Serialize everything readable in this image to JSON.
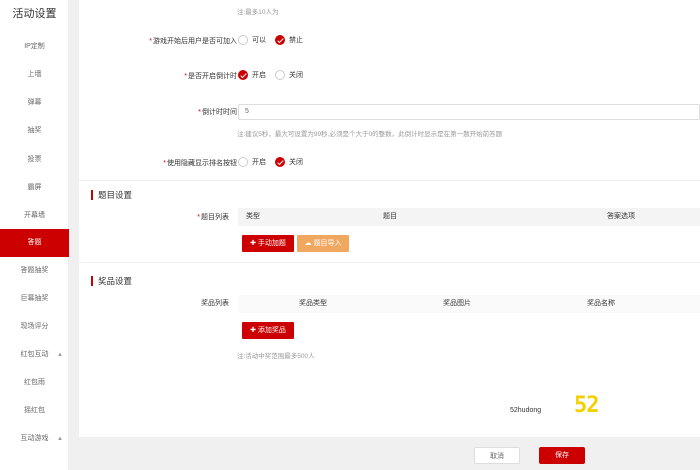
{
  "sidebar": {
    "title": "活动设置",
    "items": [
      {
        "label": "IP定制",
        "active": false
      },
      {
        "label": "上墙",
        "active": false
      },
      {
        "label": "弹幕",
        "active": false
      },
      {
        "label": "抽奖",
        "active": false
      },
      {
        "label": "投票",
        "active": false
      },
      {
        "label": "霸屏",
        "active": false
      },
      {
        "label": "开幕墙",
        "active": false
      },
      {
        "label": "答题",
        "active": true
      },
      {
        "label": "答题抽奖",
        "active": false
      },
      {
        "label": "巨幕抽奖",
        "active": false
      },
      {
        "label": "现场评分",
        "active": false
      },
      {
        "label": "红包互动",
        "active": false,
        "expandable": true
      },
      {
        "label": "红包雨",
        "active": false
      },
      {
        "label": "摇红包",
        "active": false
      },
      {
        "label": "互动游戏",
        "active": false,
        "expandable": true
      }
    ]
  },
  "form": {
    "top_note": "注:最多10人为",
    "join_label": "游戏开始后用户是否可加入",
    "join_options": [
      {
        "label": "可以",
        "checked": false
      },
      {
        "label": "禁止",
        "checked": true
      }
    ],
    "countdown_label": "是否开启倒计时",
    "countdown_options": [
      {
        "label": "开启",
        "checked": true
      },
      {
        "label": "关闭",
        "checked": false
      }
    ],
    "countdown_time_label": "倒计时时间",
    "countdown_time_value": "5",
    "countdown_note": "注:建议5秒，最大可设置为99秒,必须是个大于0的整数，此倒计时显示是在第一题开始前答题",
    "ranking_label": "使用隐藏显示排名按钮",
    "ranking_options": [
      {
        "label": "开启",
        "checked": false
      },
      {
        "label": "关闭",
        "checked": true
      }
    ]
  },
  "questions": {
    "section_title": "题目设置",
    "list_label": "题目列表",
    "columns": [
      "类型",
      "题目",
      "答案选项"
    ],
    "add_button": "✚ 手动加题",
    "import_button": "☁ 题目导入"
  },
  "prizes": {
    "section_title": "奖品设置",
    "list_label": "奖品列表",
    "columns": [
      "奖品类型",
      "奖品图片",
      "奖品名称"
    ],
    "add_button": "✚ 添加奖品",
    "note": "注:活动中奖范围最多500人"
  },
  "footer": {
    "cancel": "取消",
    "save": "保存"
  },
  "watermark": {
    "text": "52hudong",
    "logo": "52"
  },
  "colors": {
    "accent": "#cc0000",
    "import_button": "#f0a860",
    "logo": "#f5d000"
  }
}
